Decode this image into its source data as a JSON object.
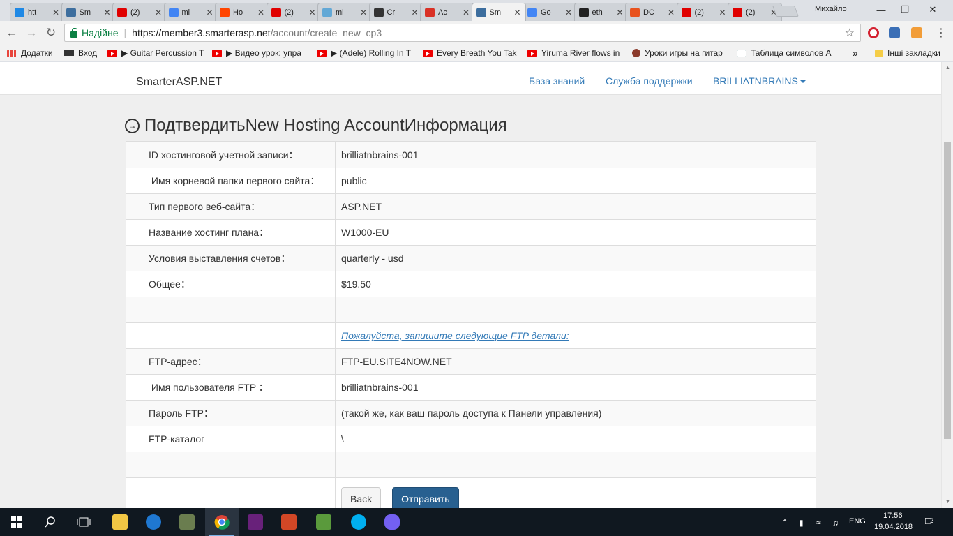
{
  "browser": {
    "tabs": [
      {
        "label": "htt",
        "favicon_color": "#1e88e5"
      },
      {
        "label": "Sm",
        "favicon_color": "#3d6e9e"
      },
      {
        "label": "(2)",
        "favicon_color": "#e00000"
      },
      {
        "label": "mi",
        "favicon_color": "#4285f4"
      },
      {
        "label": "Ho",
        "favicon_color": "#ff4500"
      },
      {
        "label": "(2)",
        "favicon_color": "#e00000"
      },
      {
        "label": "mi",
        "favicon_color": "#62a8d6"
      },
      {
        "label": "Cr",
        "favicon_color": "#333333"
      },
      {
        "label": "Ac",
        "favicon_color": "#d93025"
      },
      {
        "label": "Sm",
        "favicon_color": "#3d6e9e"
      },
      {
        "label": "Go",
        "favicon_color": "#4285f4"
      },
      {
        "label": "eth",
        "favicon_color": "#222222"
      },
      {
        "label": "DC",
        "favicon_color": "#e8531f"
      },
      {
        "label": "(2)",
        "favicon_color": "#e00000"
      },
      {
        "label": "(2)",
        "favicon_color": "#e00000"
      }
    ],
    "active_tab_index": 9,
    "user": "Михайло",
    "address": {
      "secure_label": "Надійне",
      "url_host": "https://member3.smarterasp.net",
      "url_path": "/account/create_new_cp3"
    },
    "bookmarks": [
      {
        "label": "Додатки",
        "icon": "apps-grid-icon"
      },
      {
        "label": "Вход",
        "icon": "graduation-cap-icon"
      },
      {
        "label": "▶ Guitar Percussion T",
        "icon": "youtube-icon"
      },
      {
        "label": "▶ Видео урок: упра",
        "icon": "youtube-icon"
      },
      {
        "label": "▶ (Adele) Rolling In T",
        "icon": "youtube-icon"
      },
      {
        "label": "Every Breath You Tak",
        "icon": "youtube-icon"
      },
      {
        "label": "Yiruma River flows in",
        "icon": "youtube-icon"
      },
      {
        "label": "Уроки игры на гитар",
        "icon": "g-icon"
      },
      {
        "label": "Таблица символов А",
        "icon": "table-icon"
      }
    ],
    "bookmarks_more": "»",
    "other_bookmarks": "Інші закладки"
  },
  "site": {
    "brand": "SmarterASP.NET",
    "nav": {
      "knowledge_base": "База знаний",
      "support": "Служба поддержки",
      "account": "BRILLIATNBRAINS"
    },
    "heading": "ПодтвердитьNew Hosting AccountИнформация",
    "rows": [
      {
        "label": "ID хостинговой учетной записи：",
        "value": "brilliatnbrains-001"
      },
      {
        "label": " Имя корневой папки первого сайта：",
        "value": "public"
      },
      {
        "label": "Тип первого веб-сайта：",
        "value": "ASP.NET"
      },
      {
        "label": "Название хостинг плана：",
        "value": "W1000-EU"
      },
      {
        "label": "Условия выставления счетов：",
        "value": "quarterly - usd"
      },
      {
        "label": "Общее：",
        "value": "$19.50"
      },
      {
        "label": "",
        "value": ""
      },
      {
        "label": "",
        "value": "Пожалуйста, запишите следующие FTP детали:"
      },
      {
        "label": "FTP-адрес：",
        "value": "FTP-EU.SITE4NOW.NET"
      },
      {
        "label": " Имя пользователя FTP ：",
        "value": "brilliatnbrains-001"
      },
      {
        "label": "Пароль FTP：",
        "value": "(такой же, как ваш пароль доступа к Панели управления)"
      },
      {
        "label": "FTP-каталог",
        "value": "\\"
      },
      {
        "label": "",
        "value": ""
      }
    ],
    "buttons": {
      "back": "Back",
      "submit": "Отправить"
    }
  },
  "taskbar": {
    "language": "ENG",
    "time": "17:56",
    "date": "19.04.2018",
    "notification_count": "2"
  }
}
